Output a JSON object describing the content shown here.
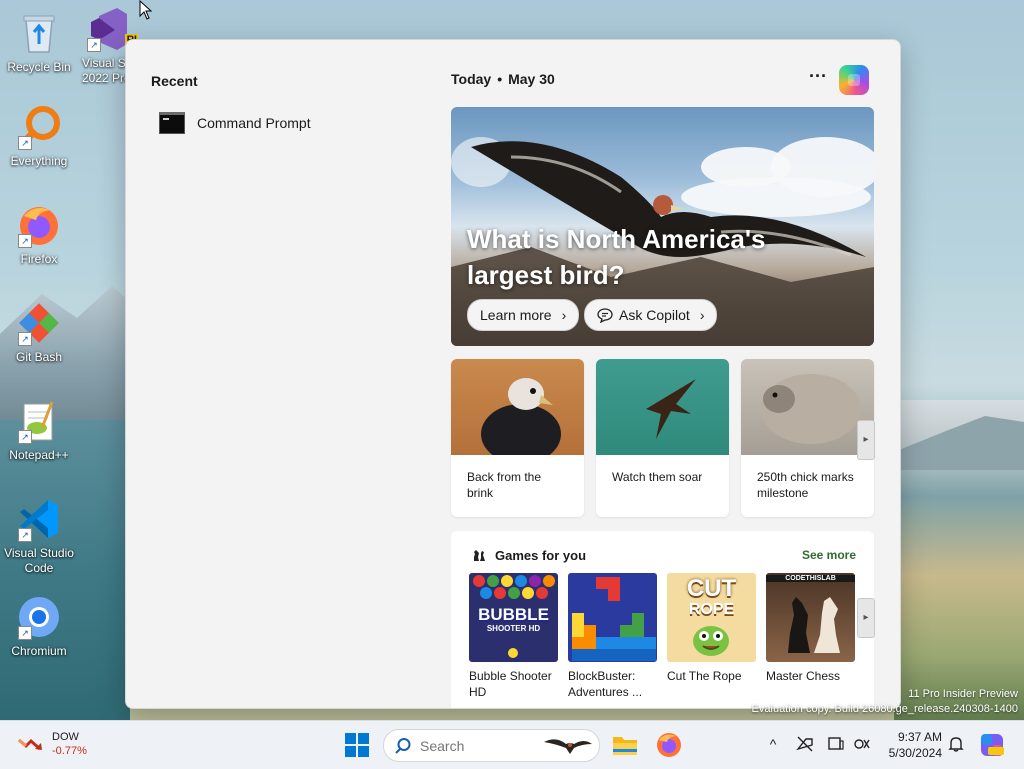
{
  "desktop": {
    "icons": [
      {
        "label": "Recycle Bin"
      },
      {
        "label": "Visual S 2022 Pre"
      },
      {
        "label": "Everything"
      },
      {
        "label": "Firefox"
      },
      {
        "label": "Git Bash"
      },
      {
        "label": "Notepad++"
      },
      {
        "label": "Visual Studio Code"
      },
      {
        "label": "Chromium"
      }
    ],
    "vs_badge": "PI"
  },
  "start_menu": {
    "recent": {
      "title": "Recent",
      "items": [
        {
          "label": "Command Prompt"
        }
      ]
    },
    "today": {
      "label": "Today",
      "separator": "•",
      "date": "May 30",
      "more": "···"
    },
    "hero": {
      "title": "What is North America's largest bird?",
      "learn_more": "Learn more",
      "ask_copilot": "Ask Copilot",
      "chevron": "›"
    },
    "news_cards": [
      {
        "caption": "Back from the brink"
      },
      {
        "caption": "Watch them soar"
      },
      {
        "caption": "250th chick marks milestone"
      }
    ],
    "games": {
      "title": "Games for you",
      "see_more": "See more",
      "items": [
        {
          "name": "Bubble Shooter HD",
          "art_text": "BUBBLE",
          "art_sub": "SHOOTER HD"
        },
        {
          "name": "BlockBuster: Adventures ..."
        },
        {
          "name": "Cut The Rope",
          "art_text": "CUT",
          "art_sub": "ROPE"
        },
        {
          "name": "Master Chess",
          "art_text": "CODETHISLAB"
        }
      ]
    },
    "scroll_arrow": "▸"
  },
  "watermark": {
    "line1": "11 Pro Insider Preview",
    "line2": "Evaluation copy. Build 26080.ge_release.240308-1400"
  },
  "taskbar": {
    "stock": {
      "name": "DOW",
      "change": "-0.77%"
    },
    "search": {
      "placeholder": "Search"
    },
    "tray": {
      "chevron": "^"
    },
    "clock": {
      "time": "9:37 AM",
      "date": "5/30/2024"
    },
    "accent": "#0067c0"
  }
}
